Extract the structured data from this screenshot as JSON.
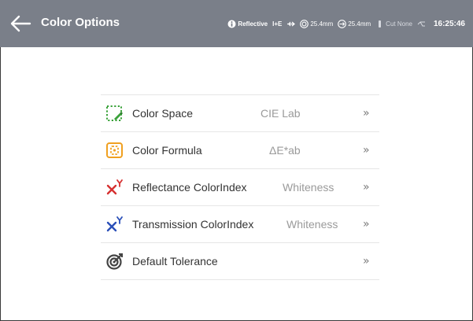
{
  "header": {
    "title": "Color Options",
    "mode": "Reflective",
    "light": "I+E",
    "aperture": "25.4mm",
    "area": "25.4mm",
    "cut": "Cut None",
    "time": "16:25:46",
    "bg_color": "#7a7f89"
  },
  "menu": [
    {
      "label": "Color Space",
      "value": "CIE Lab",
      "icon": "color-space-icon",
      "chevron": "»"
    },
    {
      "label": "Color Formula",
      "value": "ΔE*ab",
      "icon": "color-formula-icon",
      "chevron": "»"
    },
    {
      "label": "Reflectance ColorIndex",
      "value": "Whiteness",
      "icon": "reflectance-index-icon",
      "chevron": "»"
    },
    {
      "label": "Transmission ColorIndex",
      "value": "Whiteness",
      "icon": "transmission-index-icon",
      "chevron": "»"
    },
    {
      "label": "Default Tolerance",
      "value": "",
      "icon": "tolerance-icon",
      "chevron": "»"
    }
  ],
  "colors": {
    "green": "#3aa23a",
    "orange": "#f0a020",
    "red": "#d63030",
    "blue": "#2a4fb8",
    "dark": "#444444"
  }
}
